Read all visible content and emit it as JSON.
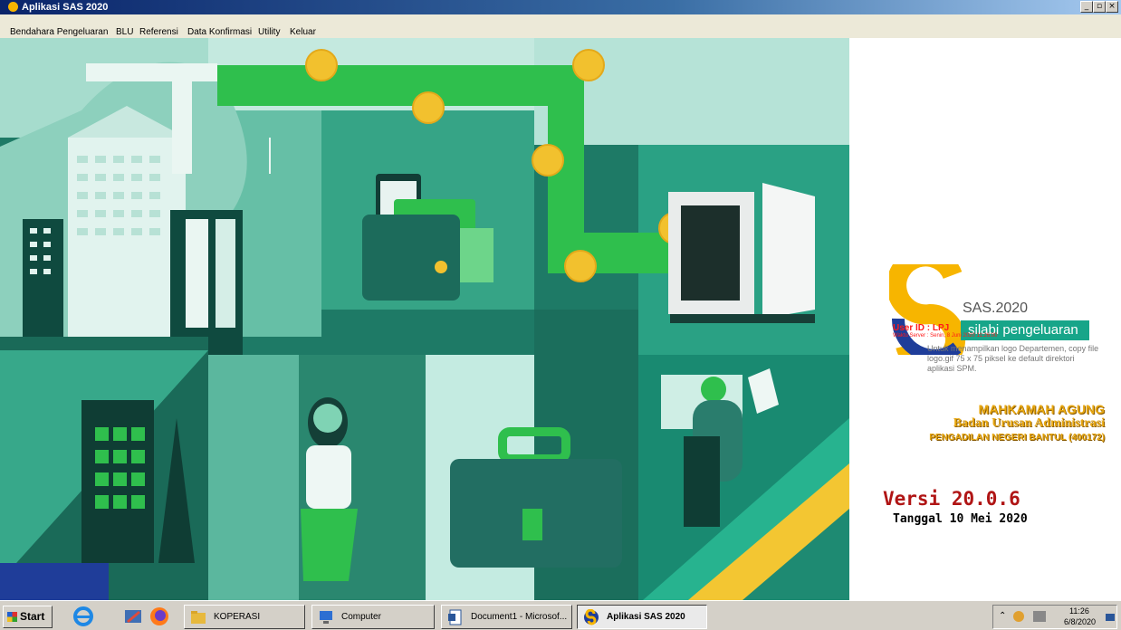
{
  "window": {
    "title": "Aplikasi SAS 2020",
    "controls": {
      "minimize": "_",
      "maximize": "▫",
      "close": "×"
    }
  },
  "menu": [
    "Bendahara Pengeluaran",
    "BLU",
    "Referensi",
    "Data Konfirmasi",
    "Utility",
    "Keluar"
  ],
  "panel": {
    "app_name": "SAS.2020",
    "tagline": "silabi pengeluaran",
    "user_line": "User ID : LPJ",
    "server_line": "Waktu Server : Senin, 8 Juni 2020 11:26:00",
    "logo_note": "Untuk menampilkan logo Departemen, copy file logo.gif 75 x 75 piksel ke default direktori aplikasi SPM.",
    "org_line1": "MAHKAMAH AGUNG",
    "org_line2": "Badan Urusan Administrasi",
    "org_line3": "PENGADILAN NEGERI BANTUL (400172)",
    "version": "Versi 20.0.6",
    "date": "Tanggal 10 Mei 2020"
  },
  "taskbar": {
    "start_label": "Start",
    "quick_launch": [
      "ie-icon",
      "tools-icon",
      "firefox-icon"
    ],
    "tasks": [
      {
        "label": "KOPERASI",
        "icon": "folder-icon",
        "active": false
      },
      {
        "label": "Computer",
        "icon": "computer-icon",
        "active": false
      },
      {
        "label": "Document1 - Microsof...",
        "icon": "word-icon",
        "active": false
      },
      {
        "label": "Aplikasi SAS 2020",
        "icon": "sas-icon",
        "active": true
      }
    ],
    "clock_time": "11:26",
    "clock_date": "6/8/2020"
  },
  "colors": {
    "accent": "#17a589",
    "brand_gold": "#f7b500",
    "brand_blue": "#1f3d99",
    "version_red": "#b01515"
  }
}
